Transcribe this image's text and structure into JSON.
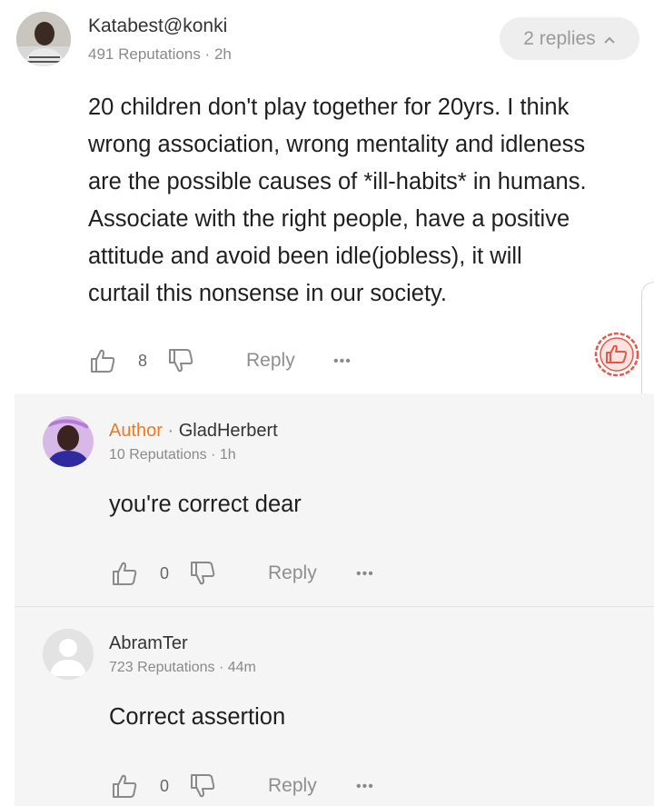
{
  "main_comment": {
    "username": "Katabest@konki",
    "reputations": "491 Reputations",
    "time": "2h",
    "replies_label": "2 replies",
    "text_lines": [
      "20 children don't play together for 20yrs. I think",
      "wrong association, wrong mentality and idleness",
      "are the possible causes of *ill-habits* in humans.",
      "Associate with the right people, have a positive",
      "attitude and avoid been idle(jobless), it will",
      "curtail this nonsense in our society."
    ],
    "likes": "8",
    "reply_label": "Reply",
    "more": "•••"
  },
  "replies": [
    {
      "author_tag": "Author",
      "username": "GladHerbert",
      "reputations": "10 Reputations",
      "time": "1h",
      "text": "you're correct dear",
      "likes": "0",
      "reply_label": "Reply",
      "more": "•••"
    },
    {
      "username": "AbramTer",
      "reputations": "723 Reputations",
      "time": "44m",
      "text": "Correct assertion",
      "likes": "0",
      "reply_label": "Reply",
      "more": "•••"
    }
  ],
  "separator": " · ",
  "colors": {
    "author_accent": "#f07a20",
    "sticker_red": "#e8564a",
    "reply_bg": "#f5f5f5"
  }
}
